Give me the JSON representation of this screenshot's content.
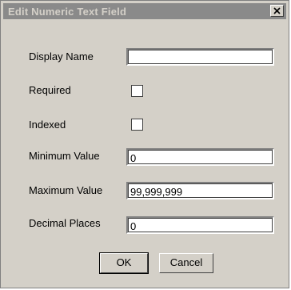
{
  "dialog": {
    "title": "Edit Numeric Text Field",
    "close_label": "X"
  },
  "fields": {
    "display_name": {
      "label": "Display Name",
      "value": ""
    },
    "required": {
      "label": "Required",
      "checked": false
    },
    "indexed": {
      "label": "Indexed",
      "checked": false
    },
    "minimum_value": {
      "label": "Minimum Value",
      "value": "0"
    },
    "maximum_value": {
      "label": "Maximum Value",
      "value": "99,999,999"
    },
    "decimal_places": {
      "label": "Decimal Places",
      "value": "0"
    }
  },
  "buttons": {
    "ok": "OK",
    "cancel": "Cancel"
  }
}
